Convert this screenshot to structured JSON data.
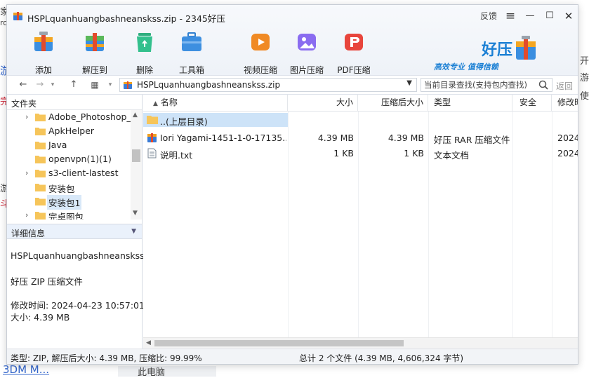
{
  "window": {
    "title": "HSPLquanhuangbashneanskss.zip - 2345好压",
    "feedback_label": "反馈",
    "menu_icon": "menu-icon",
    "minimize_icon": "minimize-icon",
    "maximize_icon": "maximize-icon",
    "close_icon": "close-icon"
  },
  "toolbar": {
    "items": [
      {
        "label": "添加",
        "icon": "add-icon"
      },
      {
        "label": "解压到",
        "icon": "extract-icon"
      },
      {
        "label": "删除",
        "icon": "delete-icon"
      },
      {
        "label": "工具箱",
        "icon": "toolbox-icon"
      },
      {
        "label": "视频压缩",
        "icon": "video-compress-icon"
      },
      {
        "label": "图片压缩",
        "icon": "image-compress-icon"
      },
      {
        "label": "PDF压缩",
        "icon": "pdf-compress-icon"
      }
    ]
  },
  "brand": {
    "name": "好压",
    "slogan": "高效专业  值得信赖",
    "accent": "#1a7fd4"
  },
  "nav": {
    "path": "HSPLquanhuangbashneanskss.zip",
    "search_placeholder": "当前目录查找(支持包内查找)",
    "return_label": "返回"
  },
  "tree": {
    "header": "文件夹",
    "items": [
      {
        "label": "Adobe_Photoshop_",
        "expandable": true
      },
      {
        "label": "ApkHelper",
        "expandable": false
      },
      {
        "label": "Java",
        "expandable": false
      },
      {
        "label": "openvpn(1)(1)",
        "expandable": false
      },
      {
        "label": "s3-client-lastest",
        "expandable": true
      },
      {
        "label": "安装包",
        "expandable": false
      },
      {
        "label": "安装包1",
        "expandable": false,
        "selected": true
      },
      {
        "label": "完卓图包",
        "expandable": true
      }
    ]
  },
  "details": {
    "header": "详细信息",
    "filename": "HSPLquanhuangbashneanskss.:",
    "filetype": "好压 ZIP 压缩文件",
    "modified": "修改时间:  2024-04-23 10:57:01",
    "size": "大小:  4.39 MB"
  },
  "file_list": {
    "columns": {
      "name": "名称",
      "size": "大小",
      "packed": "压缩后大小",
      "type": "类型",
      "security": "安全",
      "modified": "修改时"
    },
    "parent_label": "..(上层目录)",
    "rows": [
      {
        "name": "Iori Yagami-1451-1-0-17135...",
        "size": "4.39 MB",
        "packed": "4.39 MB",
        "type": "好压 RAR 压缩文件",
        "modified": "2024-",
        "icon": "rar-file-icon"
      },
      {
        "name": "说明.txt",
        "size": "1 KB",
        "packed": "1 KB",
        "type": "文本文档",
        "modified": "2024-",
        "icon": "text-file-icon"
      }
    ]
  },
  "status": {
    "left": "类型: ZIP, 解压后大小: 4.39 MB, 压缩比: 99.99%",
    "right": "总计 2 个文件 (4.39 MB, 4,606,324 字节)"
  },
  "background": {
    "fragments": [
      "家",
      "ro",
      "游",
      "完",
      "游",
      "斗",
      "3DM M...",
      "此电脑",
      "开",
      "使",
      "游"
    ]
  }
}
